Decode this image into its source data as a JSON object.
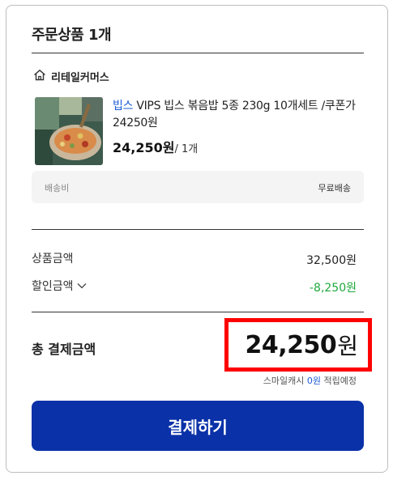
{
  "order": {
    "title": "주문상품 1개"
  },
  "seller": {
    "name": "리테일커머스",
    "icon": "home-icon"
  },
  "product": {
    "brand": "빕스",
    "name": " VIPS 빕스 볶음밥 5종 230g 10개세트 /쿠폰가24250원",
    "price": "24,250원",
    "quantity": " / 1개",
    "image_icon": "product-thumbnail"
  },
  "shipping": {
    "label": "배송비",
    "value": "무료배송"
  },
  "summary": {
    "subtotal_label": "상품금액",
    "subtotal_value": "32,500원",
    "discount_label": "할인금액",
    "discount_value": "-8,250원",
    "discount_color": "#1ea83c"
  },
  "total": {
    "label": "총 결제금액",
    "amount": "24,250",
    "unit": "원",
    "highlight_color": "#ff0000"
  },
  "smile_cash": {
    "prefix": "스마일캐시 ",
    "amount": "0원",
    "suffix": " 적립예정"
  },
  "pay_button": {
    "label": "결제하기",
    "color": "#0a31a8"
  }
}
